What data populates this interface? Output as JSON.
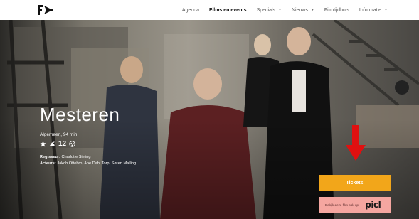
{
  "logo": {
    "text": "F",
    "icon": "film-academy-logo"
  },
  "nav": {
    "items": [
      {
        "label": "Agenda",
        "dropdown": false,
        "active": false
      },
      {
        "label": "Films en events",
        "dropdown": false,
        "active": true
      },
      {
        "label": "Specials",
        "dropdown": true,
        "active": false
      },
      {
        "label": "Nieuws",
        "dropdown": true,
        "active": false
      },
      {
        "label": "Filmtijdhuis",
        "dropdown": false,
        "active": false
      },
      {
        "label": "Informatie",
        "dropdown": true,
        "active": false
      }
    ]
  },
  "film": {
    "title": "Mesteren",
    "meta": "Algemeen, 94 min",
    "age_rating": "12",
    "director_label": "Regisseur:",
    "director": "Charlotte Sieling",
    "actors_label": "Acteurs:",
    "actors": "Jakob Oftebro, Ane Dahl Torp, Søren Malling"
  },
  "actions": {
    "tickets_label": "Tickets",
    "pickl_text": "Bekijk deze film ook op:",
    "pickl_logo": "picl"
  },
  "colors": {
    "tickets_bg": "#f2a61a",
    "pickl_bg": "#f5a6a0",
    "arrow": "#e01010"
  }
}
